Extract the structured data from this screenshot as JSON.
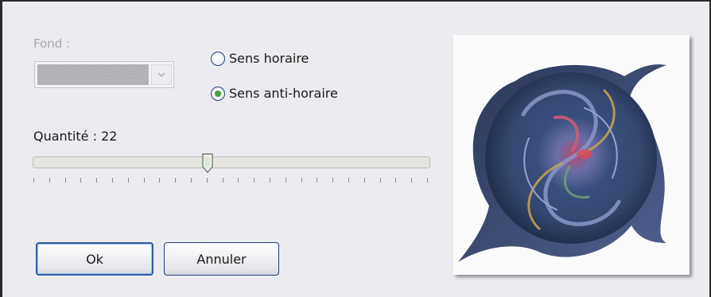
{
  "background_group": {
    "label": "Fond :"
  },
  "direction": {
    "options": [
      {
        "label": "Sens horaire",
        "selected": false
      },
      {
        "label": "Sens anti-horaire",
        "selected": true
      }
    ]
  },
  "amount": {
    "label": "Quantité : 22",
    "value": 22,
    "slider_fraction": 0.44
  },
  "buttons": {
    "ok_label": "Ok",
    "cancel_label": "Annuler"
  },
  "colors": {
    "dialog_bg": "#ececf0",
    "radio_dot": "#3ea33e",
    "button_border": "#1f3f7a"
  }
}
